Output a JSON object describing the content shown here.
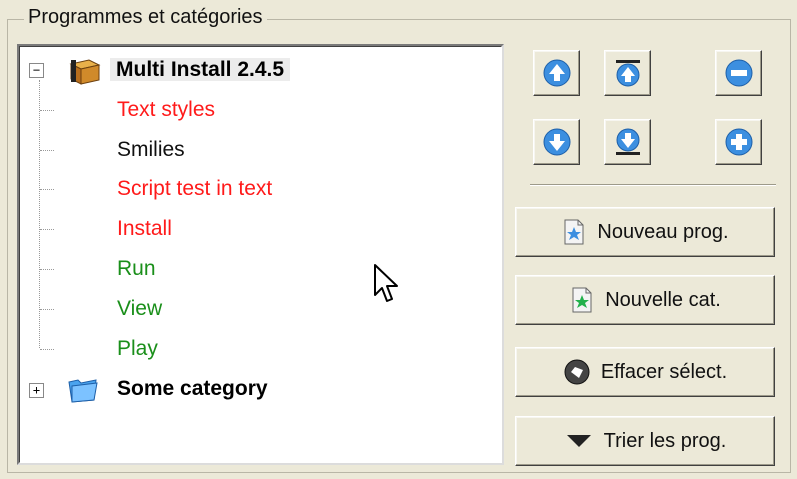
{
  "group": {
    "title": "Programmes et catégories"
  },
  "tree": {
    "root": {
      "label": "Multi Install 2.4.5",
      "expander": "−"
    },
    "children": [
      {
        "label": "Text styles",
        "color": "#ff1a1a"
      },
      {
        "label": "Smilies",
        "color": "#111111"
      },
      {
        "label": "Script test in text",
        "color": "#ff1a1a"
      },
      {
        "label": "Install",
        "color": "#ff1a1a"
      },
      {
        "label": "Run",
        "color": "#1a8f1a"
      },
      {
        "label": "View",
        "color": "#1a8f1a"
      },
      {
        "label": "Play",
        "color": "#1a8f1a"
      }
    ],
    "category": {
      "label": "Some category",
      "expander": "+"
    }
  },
  "icons": {
    "move_up": "arrow-up-icon",
    "move_top": "arrow-top-icon",
    "remove": "minus-icon",
    "move_down": "arrow-down-icon",
    "move_bottom": "arrow-bottom-icon",
    "add": "plus-icon"
  },
  "buttons": {
    "new_prog": "Nouveau prog.",
    "new_cat": "Nouvelle cat.",
    "clear_sel": "Effacer sélect.",
    "sort_prog": "Trier les prog."
  },
  "colors": {
    "accent_blue": "#3c8fe0",
    "background": "#ece9d8"
  }
}
